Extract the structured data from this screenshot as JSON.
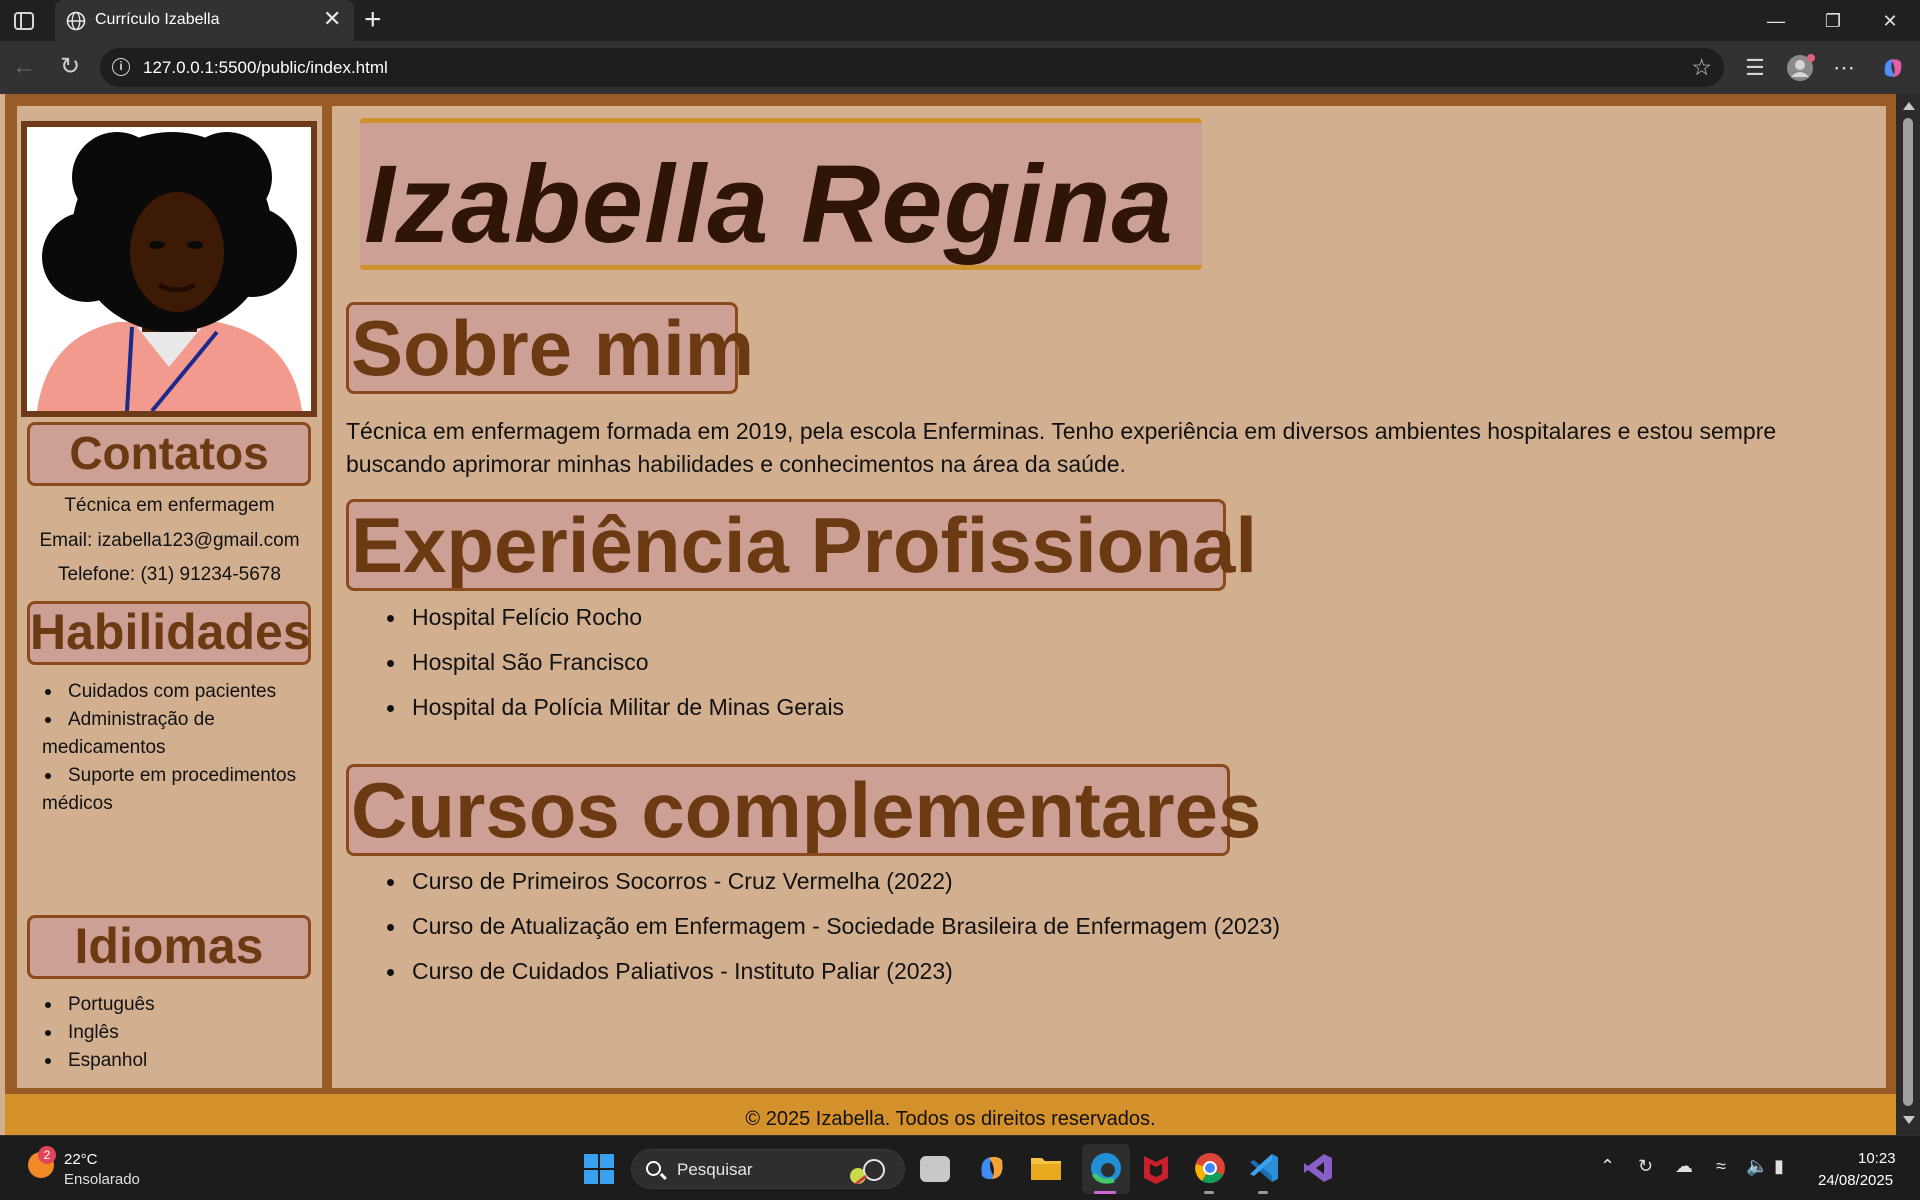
{
  "browser": {
    "tab_title": "Currículo Izabella",
    "url": "127.0.0.1:5500/public/index.html",
    "tab_close": "✕",
    "new_tab": "+"
  },
  "page": {
    "name": "Izabella Regina",
    "sidebar": {
      "contacts_heading": "Contatos",
      "role": "Técnica em enfermagem",
      "email": "Email: izabella123@gmail.com",
      "phone": "Telefone: (31) 91234-5678",
      "skills_heading": "Habilidades",
      "skills": [
        "Cuidados com pacientes",
        "Administração de medicamentos",
        "Suporte em procedimentos médicos"
      ],
      "languages_heading": "Idiomas",
      "languages": [
        "Português",
        "Inglês",
        "Espanhol"
      ]
    },
    "about": {
      "heading": "Sobre mim",
      "text": "Técnica em enfermagem formada em 2019, pela escola Enferminas. Tenho experiência em diversos ambientes hospitalares e estou sempre buscando aprimorar minhas habilidades e conhecimentos na área da saúde."
    },
    "experience": {
      "heading": "Experiência Profissional",
      "items": [
        "Hospital Felício Rocho",
        "Hospital São Francisco",
        "Hospital da Polícia Militar de Minas Gerais"
      ]
    },
    "courses": {
      "heading": "Cursos complementares",
      "items": [
        "Curso de Primeiros Socorros - Cruz Vermelha (2022)",
        "Curso de Atualização em Enfermagem - Sociedade Brasileira de Enfermagem (2023)",
        "Curso de Cuidados Paliativos - Instituto Paliar (2023)"
      ]
    },
    "footer": "© 2025 Izabella. Todos os direitos reservados."
  },
  "taskbar": {
    "weather_badge": "2",
    "weather_temp": "22°C",
    "weather_desc": "Ensolarado",
    "search_placeholder": "Pesquisar",
    "time": "10:23",
    "date": "24/08/2025"
  },
  "colors": {
    "page_bg": "#d2b08f",
    "frame": "#9a5c27",
    "heading_bg": "#cda096",
    "heading_text": "#6b3a12",
    "name_text": "#2e1505",
    "accent_gold": "#d4912b"
  }
}
